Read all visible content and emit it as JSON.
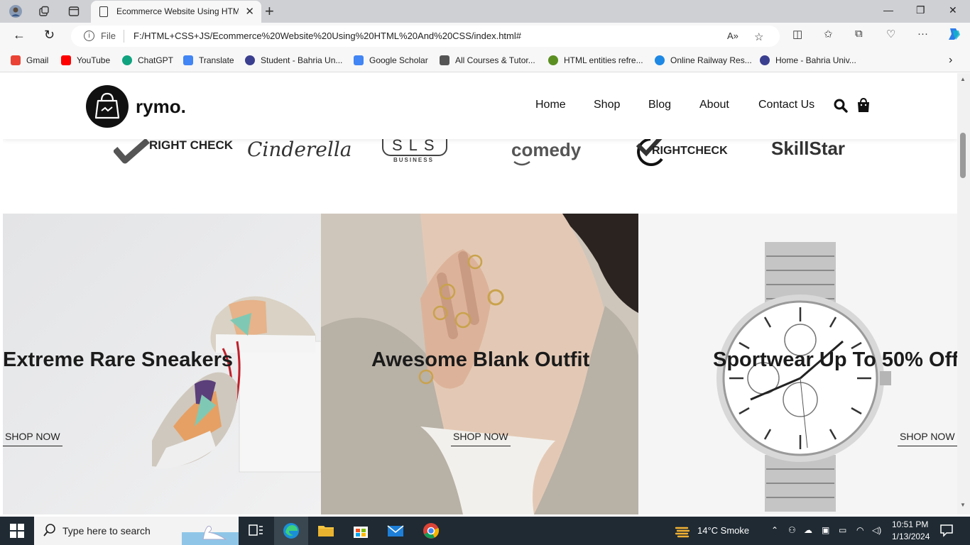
{
  "browser": {
    "tab_title": "Ecommerce Website Using HTML",
    "file_label": "File",
    "url": "F:/HTML+CSS+JS/Ecommerce%20Website%20Using%20HTML%20And%20CSS/index.html#",
    "bookmarks": [
      {
        "label": "Gmail",
        "color": "#ea4335"
      },
      {
        "label": "YouTube",
        "color": "#ff0000"
      },
      {
        "label": "ChatGPT",
        "color": "#10a37f"
      },
      {
        "label": "Translate",
        "color": "#4285f4"
      },
      {
        "label": "Student - Bahria Un...",
        "color": "#3b3f8f"
      },
      {
        "label": "Google Scholar",
        "color": "#4285f4"
      },
      {
        "label": "All Courses & Tutor...",
        "color": "#555555"
      },
      {
        "label": "HTML entities refre...",
        "color": "#5b8f22"
      },
      {
        "label": "Online Railway Res...",
        "color": "#1e88e5"
      },
      {
        "label": "Home - Bahria Univ...",
        "color": "#3b3f8f"
      }
    ]
  },
  "site": {
    "logo_text": "rymo.",
    "nav": [
      "Home",
      "Shop",
      "Blog",
      "About",
      "Contact Us"
    ],
    "brands": [
      "RIGHT CHECK",
      "Cinderella",
      "SLS",
      "BUSINESS",
      "comedy",
      "RIGHTCHECK",
      "SkillStar"
    ],
    "banners": [
      {
        "title": "Extreme Rare Sneakers",
        "cta": "SHOP NOW"
      },
      {
        "title": "Awesome Blank Outfit",
        "cta": "SHOP NOW"
      },
      {
        "title": "Sportwear Up To 50% Off",
        "cta": "SHOP NOW"
      }
    ]
  },
  "taskbar": {
    "search_placeholder": "Type here to search",
    "weather": "14°C  Smoke",
    "time": "10:51 PM",
    "date": "1/13/2024"
  }
}
